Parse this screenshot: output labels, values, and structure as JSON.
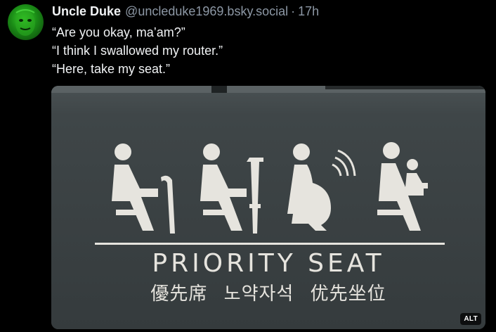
{
  "post": {
    "author": {
      "display_name": "Uncle Duke",
      "handle": "@uncleduke1969.bsky.social",
      "separator": "·",
      "timestamp": "17h"
    },
    "text_lines": [
      "“Are you okay, ma’am?”",
      "“I think I swallowed my router.”",
      "“Here, take my seat.”"
    ],
    "image": {
      "sign_title": "PRIORITY SEAT",
      "sign_subtitle": "優先席 노약자석 优先坐位",
      "alt_badge": "ALT",
      "icons": [
        "elderly-cane-icon",
        "crutch-icon",
        "pregnant-wifi-icon",
        "parent-child-icon"
      ]
    }
  },
  "colors": {
    "background": "#000000",
    "text": "#f1f3f5",
    "muted": "#8d98a5",
    "sign_panel": "#3c4244",
    "sign_ink": "#e6e4de"
  }
}
